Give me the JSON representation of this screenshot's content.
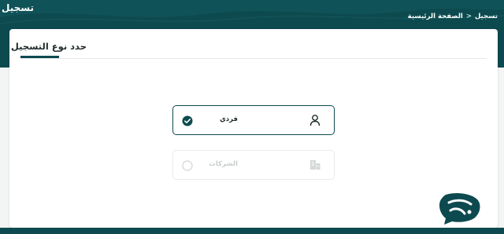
{
  "header": {
    "title": "تسجيل",
    "breadcrumb": {
      "home": "الصفحة الرئيسية",
      "separator": "<",
      "current": "تسجيل"
    },
    "background_color": "#0d4a4f"
  },
  "card": {
    "title": "حدد نوع التسجيل",
    "options": [
      {
        "label": "فردي",
        "icon": "user-icon",
        "selected": true,
        "enabled": true
      },
      {
        "label": "الشركات",
        "icon": "company-icon",
        "selected": false,
        "enabled": false
      }
    ]
  },
  "colors": {
    "primary": "#0d4a4f",
    "disabled_text": "#c7cccc",
    "border_light": "#e9ecec"
  },
  "chat_widget": {
    "icon": "chat-widget-icon"
  }
}
